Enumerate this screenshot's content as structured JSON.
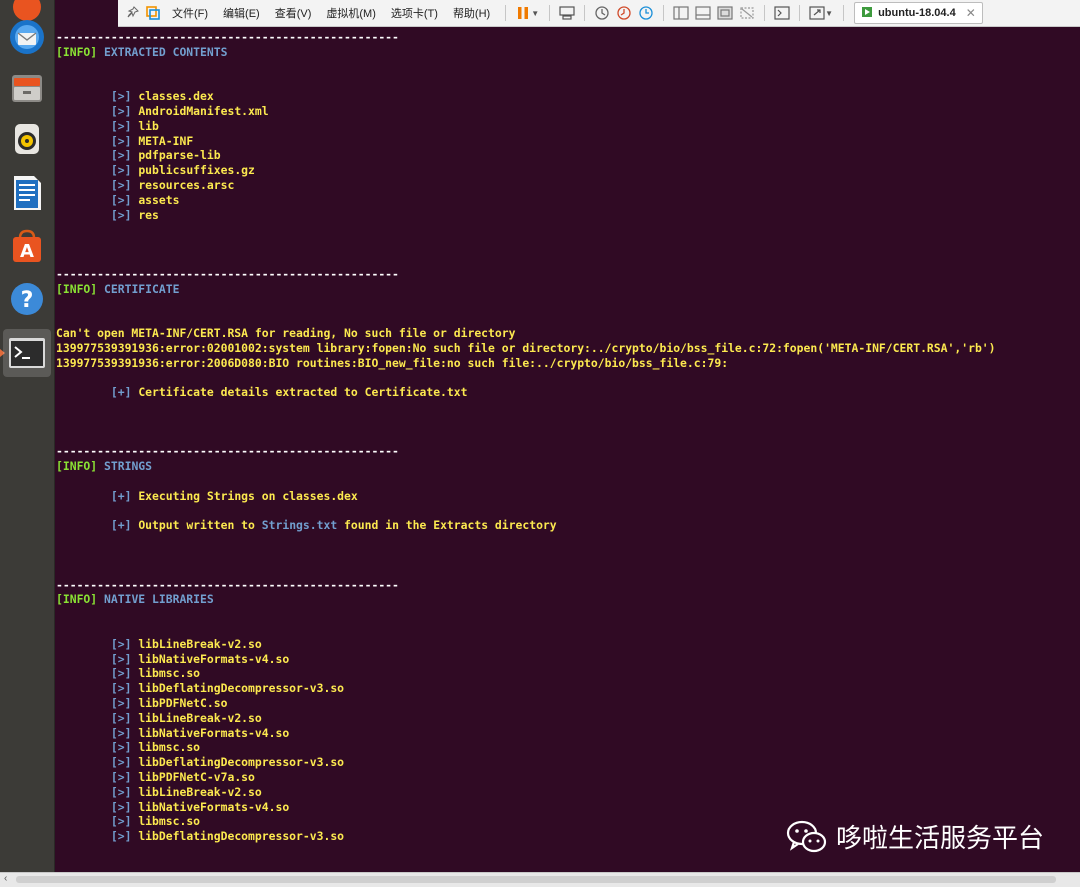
{
  "toolbar": {
    "menus": [
      "文件(F)",
      "编辑(E)",
      "查看(V)",
      "虚拟机(M)",
      "选项卡(T)",
      "帮助(H)"
    ],
    "vm_tab_label": "ubuntu-18.04.4"
  },
  "launcher": {
    "apps": [
      "thunderbird-icon",
      "files-icon",
      "rhythmbox-icon",
      "libreoffice-writer-icon",
      "software-center-icon",
      "help-icon",
      "terminal-icon"
    ]
  },
  "terminal": {
    "divider": "--------------------------------------------------",
    "info_tag": "[INFO]",
    "sections": {
      "extracted": {
        "title": "EXTRACTED CONTENTS",
        "bullet": "[>]",
        "items": [
          "classes.dex",
          "AndroidManifest.xml",
          "lib",
          "META-INF",
          "pdfparse-lib",
          "publicsuffixes.gz",
          "resources.arsc",
          "assets",
          "res"
        ]
      },
      "certificate": {
        "title": "CERTIFICATE",
        "errors": [
          "Can't open META-INF/CERT.RSA for reading, No such file or directory",
          "139977539391936:error:02001002:system library:fopen:No such file or directory:../crypto/bio/bss_file.c:72:fopen('META-INF/CERT.RSA','rb')",
          "139977539391936:error:2006D080:BIO routines:BIO_new_file:no such file:../crypto/bio/bss_file.c:79:"
        ],
        "plus": "[+]",
        "result": "Certificate details extracted to Certificate.txt"
      },
      "strings": {
        "title": "STRINGS",
        "plus": "[+]",
        "executing": "Executing Strings on classes.dex",
        "output_prefix": "Output written to ",
        "output_file": "Strings.txt",
        "output_suffix": " found in the Extracts directory"
      },
      "native": {
        "title": "NATIVE LIBRARIES",
        "bullet": "[>]",
        "items": [
          "libLineBreak-v2.so",
          "libNativeFormats-v4.so",
          "libmsc.so",
          "libDeflatingDecompressor-v3.so",
          "libPDFNetC.so",
          "libLineBreak-v2.so",
          "libNativeFormats-v4.so",
          "libmsc.so",
          "libDeflatingDecompressor-v3.so",
          "libPDFNetC-v7a.so",
          "libLineBreak-v2.so",
          "libNativeFormats-v4.so",
          "libmsc.so",
          "libDeflatingDecompressor-v3.so"
        ]
      }
    }
  },
  "watermark": {
    "text": "哆啦生活服务平台"
  },
  "colors": {
    "terminal_bg": "#300a24",
    "info_tag": "#8ae234",
    "section_title": "#729fcf",
    "list_text": "#fce94f"
  }
}
